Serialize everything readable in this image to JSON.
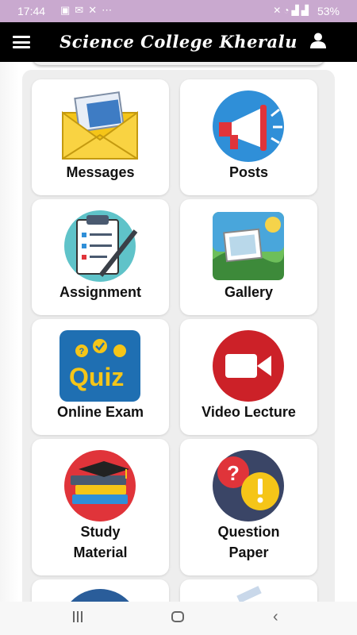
{
  "status_bar": {
    "time": "17:44",
    "left_icons": [
      "image-icon",
      "email-icon",
      "missed-call-icon",
      "more-icon"
    ],
    "right_icons": [
      "mute-icon",
      "wifi-icon",
      "volte-icon",
      "signal-icon",
      "signal-icon"
    ],
    "battery": "53%"
  },
  "app_bar": {
    "title": "Science College Kheralu",
    "left_icon": "menu-icon",
    "right_icon": "user-icon"
  },
  "tiles": [
    {
      "label": "Messages",
      "icon": "envelope-icon"
    },
    {
      "label": "Posts",
      "icon": "megaphone-icon"
    },
    {
      "label": "Assignment",
      "icon": "clipboard-icon"
    },
    {
      "label": "Gallery",
      "icon": "picture-icon"
    },
    {
      "label": "Online Exam",
      "icon": "quiz-icon"
    },
    {
      "label": "Video Lecture",
      "icon": "video-camera-icon"
    },
    {
      "label": "Study\nMaterial",
      "icon": "books-icon"
    },
    {
      "label": "Question\nPaper",
      "icon": "question-icon"
    }
  ],
  "nav_bar": {
    "items": [
      "recent-apps-icon",
      "home-icon",
      "back-icon"
    ]
  },
  "colors": {
    "status_bar": "#c9a9cf",
    "app_bar": "#000000",
    "panel": "#eeeeee",
    "card": "#ffffff"
  }
}
